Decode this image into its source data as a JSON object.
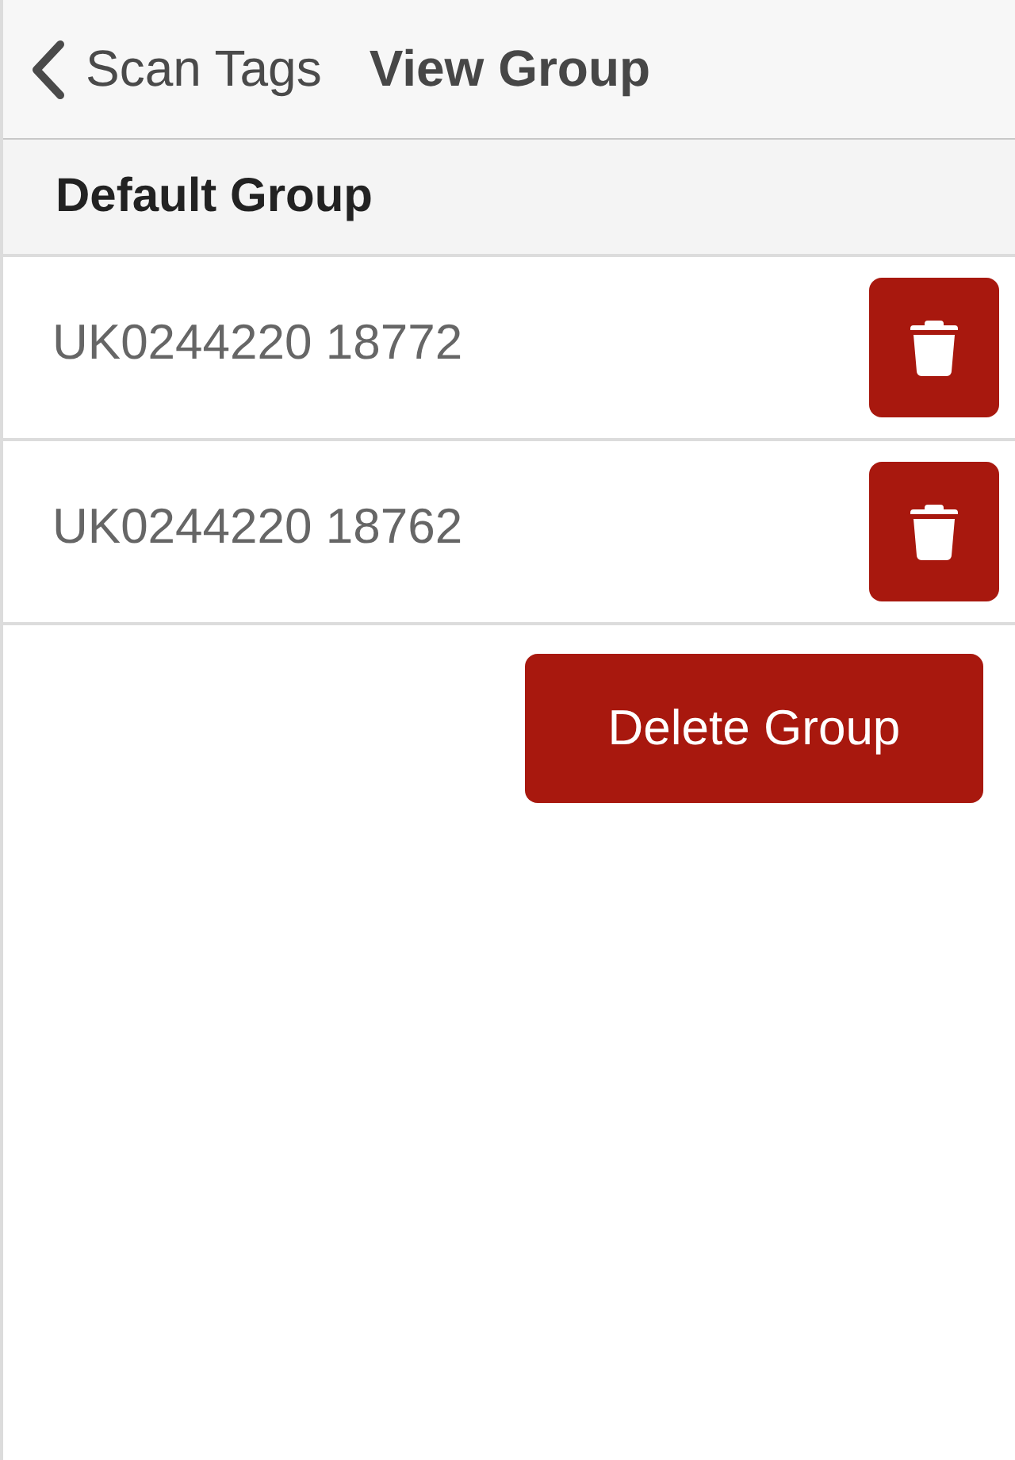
{
  "nav_bar": {
    "back_button": {
      "label": "Scan Tags"
    },
    "title": "View Group"
  },
  "group": {
    "name": "Default Group"
  },
  "tags": [
    {
      "label": "UK0244220 18772"
    },
    {
      "label": "UK0244220 18762"
    }
  ],
  "delete_group_button": {
    "label": "Delete Group"
  }
}
